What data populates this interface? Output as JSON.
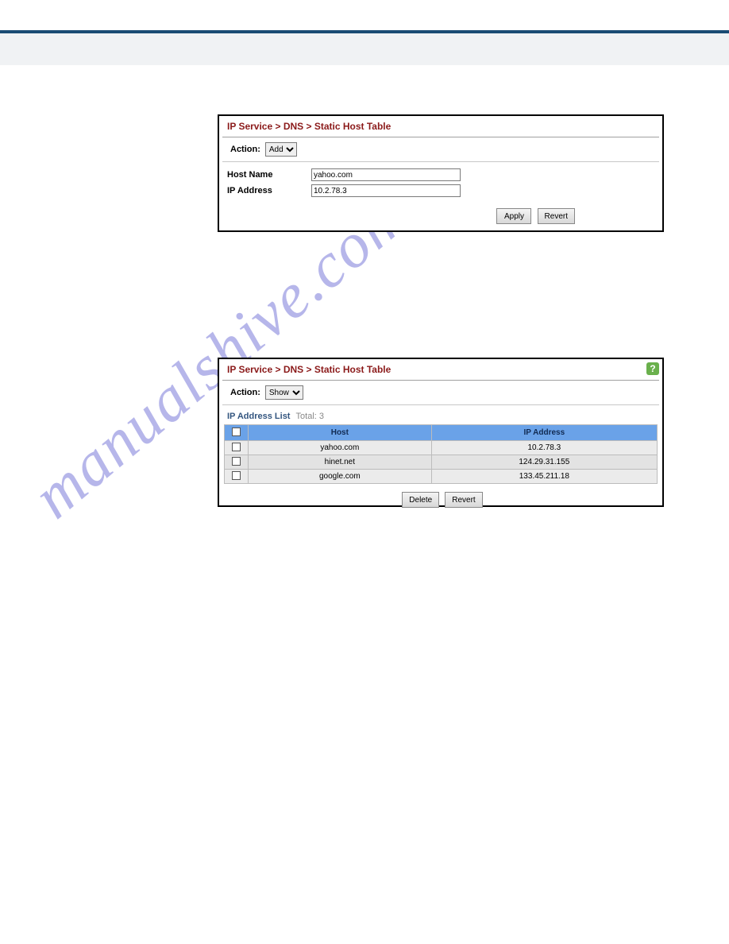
{
  "watermark": "manualshive.com",
  "panel1": {
    "breadcrumb": "IP Service > DNS > Static Host Table",
    "action_label": "Action:",
    "action_value": "Add",
    "host_label": "Host Name",
    "host_value": "yahoo.com",
    "ip_label": "IP Address",
    "ip_value": "10.2.78.3",
    "apply": "Apply",
    "revert": "Revert"
  },
  "panel2": {
    "breadcrumb": "IP Service > DNS > Static Host Table",
    "action_label": "Action:",
    "action_value": "Show",
    "list_title": "IP Address List",
    "total_label": "Total: 3",
    "col_host": "Host",
    "col_ip": "IP Address",
    "rows": [
      {
        "host": "yahoo.com",
        "ip": "10.2.78.3"
      },
      {
        "host": "hinet.net",
        "ip": "124.29.31.155"
      },
      {
        "host": "google.com",
        "ip": "133.45.211.18"
      }
    ],
    "delete": "Delete",
    "revert": "Revert",
    "help": "?"
  }
}
